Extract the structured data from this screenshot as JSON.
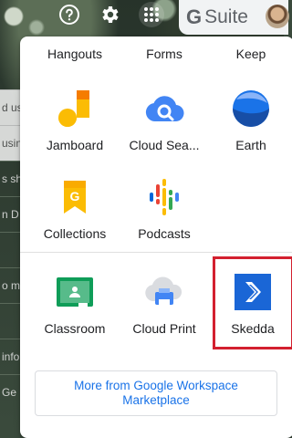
{
  "background": {
    "rows": [
      "d us",
      "usin",
      "s sh",
      "n D",
      "",
      "o m",
      "",
      "info",
      "Ge"
    ]
  },
  "toolbar": {
    "help_icon": "help-icon",
    "settings_icon": "gear-icon",
    "apps_icon": "apps-grid-icon",
    "brand_g": "G",
    "brand_text": "Suite"
  },
  "launcher": {
    "top_row": [
      "Hangouts",
      "Forms",
      "Keep"
    ],
    "apps_row1": [
      {
        "label": "Jamboard",
        "icon": "jamboard-icon"
      },
      {
        "label": "Cloud Sea...",
        "icon": "cloud-search-icon"
      },
      {
        "label": "Earth",
        "icon": "earth-icon"
      }
    ],
    "apps_row2": [
      {
        "label": "Collections",
        "icon": "collections-icon"
      },
      {
        "label": "Podcasts",
        "icon": "podcasts-icon"
      }
    ],
    "apps_row3": [
      {
        "label": "Classroom",
        "icon": "classroom-icon"
      },
      {
        "label": "Cloud Print",
        "icon": "cloud-print-icon"
      },
      {
        "label": "Skedda",
        "icon": "skedda-icon"
      }
    ],
    "more_line1": "More from Google Workspace",
    "more_line2": "Marketplace"
  },
  "colors": {
    "highlight": "#d3202f",
    "link": "#1a73e8",
    "skedda": "#1a66d6"
  }
}
